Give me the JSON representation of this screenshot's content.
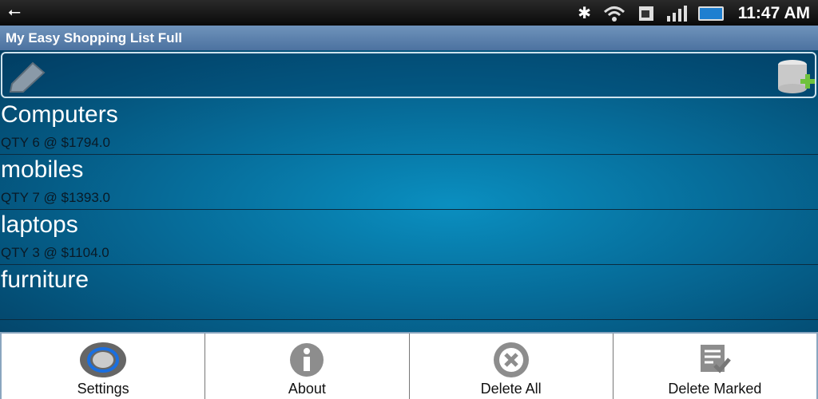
{
  "status_bar": {
    "time": "11:47 AM",
    "icons": [
      "usb-icon",
      "bluetooth-icon",
      "wifi-icon",
      "sim-icon",
      "signal-icon",
      "battery-charging-icon"
    ]
  },
  "app": {
    "title": "My Easy Shopping List Full"
  },
  "items": [
    {
      "name": "Computers",
      "qty": "QTY 6 @ $1794.0"
    },
    {
      "name": "mobiles",
      "qty": "QTY 7 @ $1393.0"
    },
    {
      "name": "laptops",
      "qty": "QTY 3 @ $1104.0"
    },
    {
      "name": "furniture",
      "qty": ""
    }
  ],
  "menu": [
    {
      "label": "Settings",
      "icon": "settings-knob-icon"
    },
    {
      "label": "About",
      "icon": "info-icon"
    },
    {
      "label": "Delete All",
      "icon": "delete-x-icon"
    },
    {
      "label": "Delete Marked",
      "icon": "checklist-icon"
    }
  ]
}
